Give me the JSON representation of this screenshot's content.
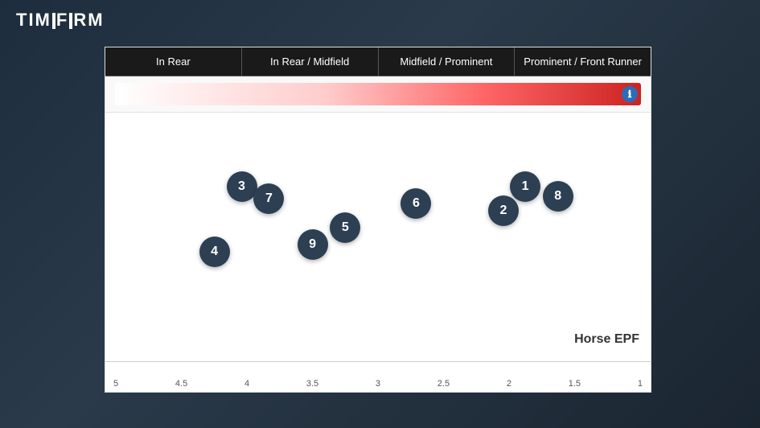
{
  "brand": {
    "name": "TIMEFORM"
  },
  "chart": {
    "categories": [
      "In Rear",
      "In Rear / Midfield",
      "Midfield / Prominent",
      "Prominent / Front Runner"
    ],
    "gradient_bar_info": "ℹ",
    "x_axis_label": "Horse EPF",
    "x_axis_ticks": [
      "5",
      "4.5",
      "4",
      "3.5",
      "3",
      "2.5",
      "2",
      "1.5",
      "1"
    ],
    "data_points": [
      {
        "label": "3",
        "x_pct": 25,
        "y_pct": 28
      },
      {
        "label": "7",
        "x_pct": 30,
        "y_pct": 33
      },
      {
        "label": "4",
        "x_pct": 20,
        "y_pct": 55
      },
      {
        "label": "9",
        "x_pct": 38,
        "y_pct": 52
      },
      {
        "label": "5",
        "x_pct": 44,
        "y_pct": 45
      },
      {
        "label": "6",
        "x_pct": 57,
        "y_pct": 35
      },
      {
        "label": "1",
        "x_pct": 77,
        "y_pct": 28
      },
      {
        "label": "2",
        "x_pct": 73,
        "y_pct": 38
      },
      {
        "label": "8",
        "x_pct": 83,
        "y_pct": 32
      }
    ]
  }
}
